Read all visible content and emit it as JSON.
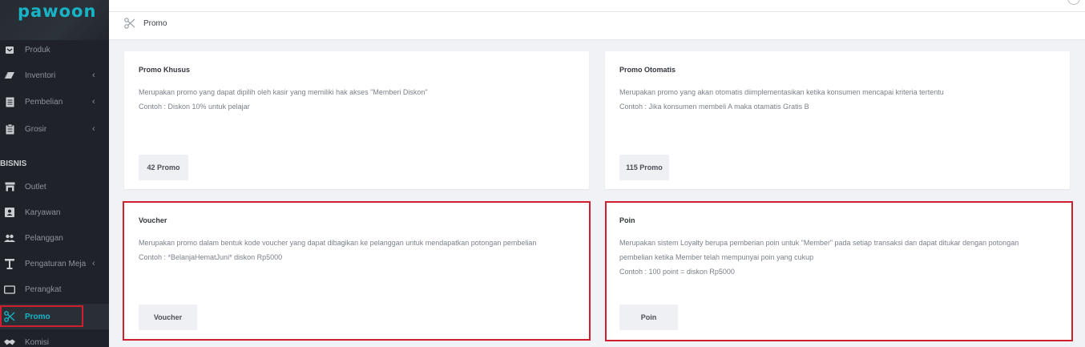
{
  "app": {
    "logo": "pawoon"
  },
  "sidebar": {
    "items": [
      {
        "label": "Produk",
        "icon": "product-icon"
      },
      {
        "label": "Inventori",
        "icon": "inventory-icon",
        "chevron": "‹"
      },
      {
        "label": "Pembelian",
        "icon": "purchase-icon",
        "chevron": "‹"
      },
      {
        "label": "Grosir",
        "icon": "wholesale-icon",
        "chevron": "‹"
      }
    ],
    "section": "BISNIS",
    "business_items": [
      {
        "label": "Outlet",
        "icon": "store-icon"
      },
      {
        "label": "Karyawan",
        "icon": "employee-icon"
      },
      {
        "label": "Pelanggan",
        "icon": "customers-icon"
      },
      {
        "label": "Pengaturan Meja",
        "icon": "table-icon",
        "chevron": "‹"
      },
      {
        "label": "Perangkat",
        "icon": "device-icon"
      },
      {
        "label": "Promo",
        "icon": "scissors-icon",
        "active": true
      },
      {
        "label": "Komisi",
        "icon": "handshake-icon"
      }
    ]
  },
  "header": {
    "breadcrumb": "Promo"
  },
  "cards": [
    {
      "title": "Promo Khusus",
      "lines": [
        "Merupakan promo yang dapat dipilih oleh kasir yang memiliki hak akses \"Memberi Diskon\"",
        "Contoh : Diskon 10% untuk pelajar"
      ],
      "button": "42 Promo"
    },
    {
      "title": "Promo Otomatis",
      "lines": [
        "Merupakan promo yang akan otomatis diimplementasikan ketika konsumen mencapai kriteria tertentu",
        "Contoh : Jika konsumen membeli A maka otamatis Gratis B"
      ],
      "button": "115 Promo"
    },
    {
      "title": "Voucher",
      "lines": [
        "Merupakan promo dalam bentuk kode voucher yang dapat dibagikan ke pelanggan untuk mendapatkan potongan pembelian",
        "Contoh : *BelanjaHematJuni* diskon Rp5000"
      ],
      "button": "Voucher"
    },
    {
      "title": "Poin",
      "lines": [
        "Merupakan sistem Loyalty berupa pemberian poin untuk \"Member\" pada setiap transaksi dan dapat ditukar dengan potongan",
        "pembelian ketika Member telah mempunyai poin yang cukup",
        "Contoh : 100 point = diskon Rp5000"
      ],
      "button": "Poin"
    }
  ],
  "colors": {
    "accent": "#18b4c6",
    "sidebar_bg": "#1f2329",
    "highlight": "#d0202f"
  }
}
